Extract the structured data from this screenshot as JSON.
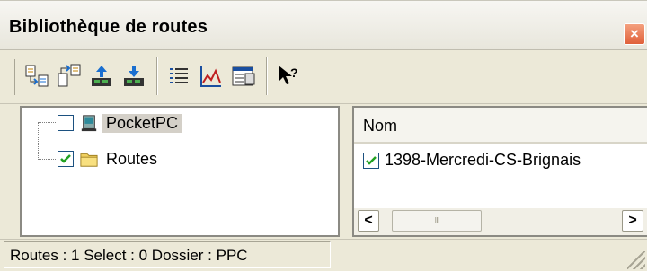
{
  "window": {
    "title": "Bibliothèque de routes",
    "close_glyph": "×"
  },
  "toolbar": {
    "buttons": [
      {
        "name": "import-route-icon"
      },
      {
        "name": "export-route-icon"
      },
      {
        "name": "upload-to-device-icon"
      },
      {
        "name": "download-from-device-icon"
      },
      {
        "name": "list-view-icon"
      },
      {
        "name": "elevation-profile-icon"
      },
      {
        "name": "properties-icon"
      },
      {
        "name": "whats-this-help-icon"
      }
    ]
  },
  "tree": {
    "items": [
      {
        "label": "PocketPC",
        "checked": false,
        "icon": "pocketpc-device-icon",
        "selected": true
      },
      {
        "label": "Routes",
        "checked": true,
        "icon": "folder-icon",
        "selected": false
      }
    ]
  },
  "list": {
    "column_header": "Nom",
    "items": [
      {
        "label": "1398-Mercredi-CS-Brignais",
        "checked": true
      }
    ],
    "scrollbar": {
      "left_arrow": "<",
      "right_arrow": ">",
      "thumb_grip": "III"
    }
  },
  "statusbar": {
    "text": "Routes : 1 Select : 0 Dossier : PPC"
  },
  "colors": {
    "window_bg": "#ece9d8",
    "checkmark_green": "#21a121",
    "close_button": "#e0603a",
    "selection_bg": "#d4d0c8"
  }
}
